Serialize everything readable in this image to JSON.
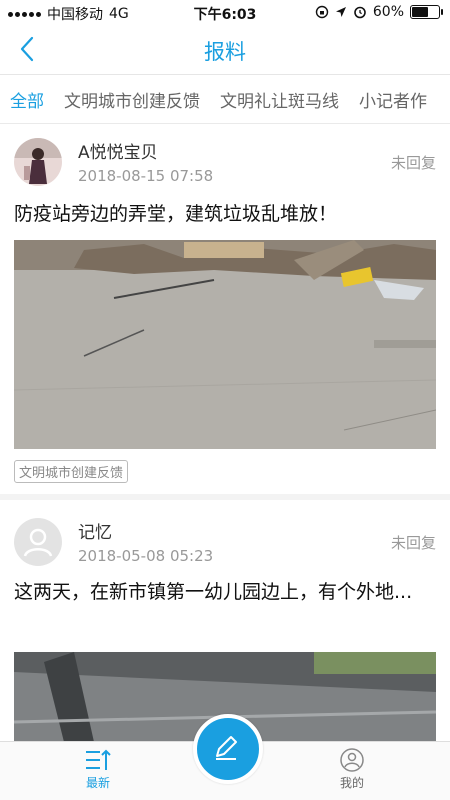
{
  "status_bar": {
    "carrier": "中国移动",
    "network": "4G",
    "time": "下午6:03",
    "battery": "60%",
    "battery_level": 0.6
  },
  "header": {
    "title": "报料",
    "back_icon": "chevron-left-icon"
  },
  "tabs": [
    {
      "label": "全部",
      "active": true
    },
    {
      "label": "文明城市创建反馈",
      "active": false
    },
    {
      "label": "文明礼让斑马线",
      "active": false
    },
    {
      "label": "小记者作",
      "active": false
    }
  ],
  "posts": [
    {
      "user": "A悦悦宝贝",
      "time": "2018-08-15 07:58",
      "status": "未回复",
      "content": "防疫站旁边的弄堂，建筑垃圾乱堆放！",
      "category": "文明城市创建反馈"
    },
    {
      "user": "记忆",
      "time": "2018-05-08 05:23",
      "status": "未回复",
      "content": "这两天，在新市镇第一幼儿园边上，有个外地..."
    }
  ],
  "tabbar": {
    "latest": "最新",
    "mine": "我的",
    "accent_color": "#1a9fe0"
  }
}
